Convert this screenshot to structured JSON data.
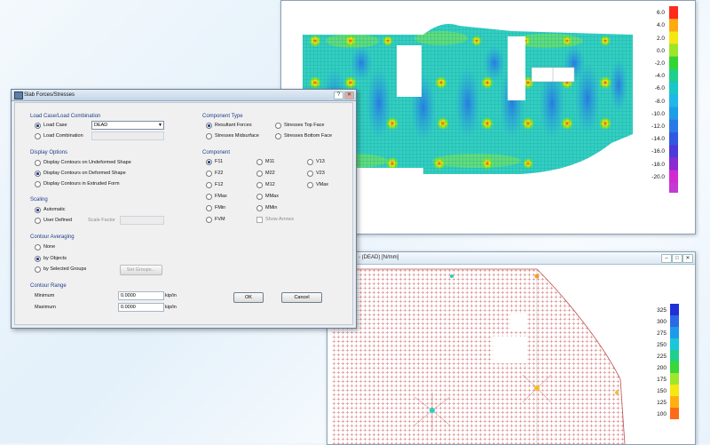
{
  "dialog": {
    "title": "Slab Forces/Stresses",
    "title_buttons": [
      "?",
      "✕"
    ],
    "load_group": {
      "title": "Load Case/Load Combination",
      "load_case_label": "Load Case",
      "load_combination_label": "Load Combination",
      "load_case_value": "DEAD",
      "selected": "Load Case"
    },
    "display_group": {
      "title": "Display Options",
      "options": [
        "Display Contours on Undeformed Shape",
        "Display Contours on Deformed Shape",
        "Display Contours in Extruded Form"
      ],
      "selected": "Display Contours on Deformed Shape"
    },
    "scaling_group": {
      "title": "Scaling",
      "options": [
        "Automatic",
        "User Defined"
      ],
      "selected": "Automatic",
      "scale_factor_label": "Scale Factor"
    },
    "averaging_group": {
      "title": "Contour Averaging",
      "options": [
        "None",
        "by Objects",
        "by Selected Groups"
      ],
      "selected": "by Objects",
      "set_groups_label": "Set Groups..."
    },
    "range_group": {
      "title": "Contour Range",
      "minimum_label": "Minimum",
      "maximum_label": "Maximum",
      "minimum_value": "0.0000",
      "maximum_value": "0.0000",
      "unit": "kip/in"
    },
    "component_type_group": {
      "title": "Component Type",
      "options": [
        "Resultant Forces",
        "Stresses Top Face",
        "Stresses Midsurface",
        "Stresses Bottom Face"
      ],
      "selected": "Resultant Forces"
    },
    "component_group": {
      "title": "Component",
      "col1": [
        "F11",
        "F22",
        "F12",
        "FMax",
        "FMin",
        "FVM"
      ],
      "col2": [
        "M11",
        "M22",
        "M12",
        "MMax",
        "MMin"
      ],
      "col3": [
        "V13",
        "V23",
        "VMax"
      ],
      "selected": "F11",
      "show_arrows_label": "Show Arrows"
    },
    "ok_label": "OK",
    "cancel_label": "Cancel"
  },
  "top_plot": {
    "scale_values": [
      "6.0",
      "4.0",
      "2.0",
      "0.0",
      "-2.0",
      "-4.0",
      "-6.0",
      "-8.0",
      "-10.0",
      "-12.0",
      "-14.0",
      "-16.0",
      "-18.0",
      "-20.0"
    ],
    "scale_colors": [
      "#ff2a1a",
      "#ffaa10",
      "#f5e812",
      "#9be62a",
      "#32d632",
      "#1fd08a",
      "#18c8c8",
      "#20b8e8",
      "#1a9ee8",
      "#2a7ae6",
      "#3058e0",
      "#4a3ad8",
      "#8a2ad0",
      "#d22ad2"
    ]
  },
  "bottom_plot": {
    "title": "n - (DEAD) [N/mm]",
    "scale_values": [
      "325",
      "300",
      "275",
      "250",
      "225",
      "200",
      "175",
      "150",
      "125",
      "100"
    ],
    "scale_colors": [
      "#2030d8",
      "#2a6ae6",
      "#1f9ae8",
      "#18c8d8",
      "#1fd08a",
      "#3ad63a",
      "#a0e62a",
      "#f5e812",
      "#ffb010",
      "#ff6a18"
    ]
  }
}
